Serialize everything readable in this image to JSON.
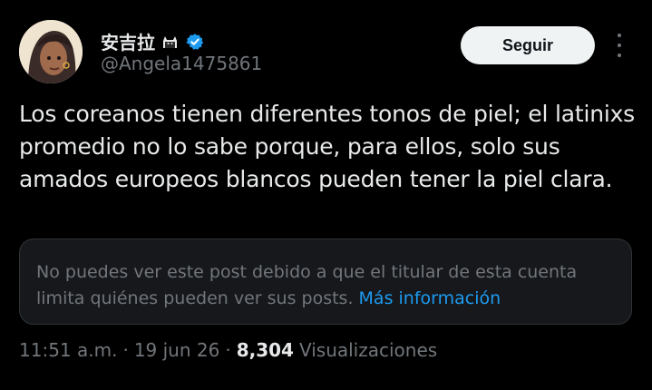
{
  "author": {
    "display_name": "安吉拉",
    "handle": "@Angela1475861",
    "emoji_icon": "cat-icon",
    "verified_icon": "verified-badge-icon",
    "verified_color": "#1d9bf0"
  },
  "actions": {
    "follow_label": "Seguir",
    "more_icon": "more-dots-icon"
  },
  "tweet": {
    "text": "Los coreanos tienen diferentes tonos de piel; el latinixs promedio no lo sabe porque, para ellos, solo sus amados europeos blancos pueden tener la piel clara."
  },
  "notice": {
    "text": "No puedes ver este post debido a que el titular de esta cuenta limita quiénes pueden ver sus posts.",
    "link_label": "Más información",
    "link_color": "#1d9bf0"
  },
  "meta": {
    "time": "11:51 a.m.",
    "separator": "·",
    "date": "19 jun 26",
    "views_count": "8,304",
    "views_label": "Visualizaciones"
  }
}
